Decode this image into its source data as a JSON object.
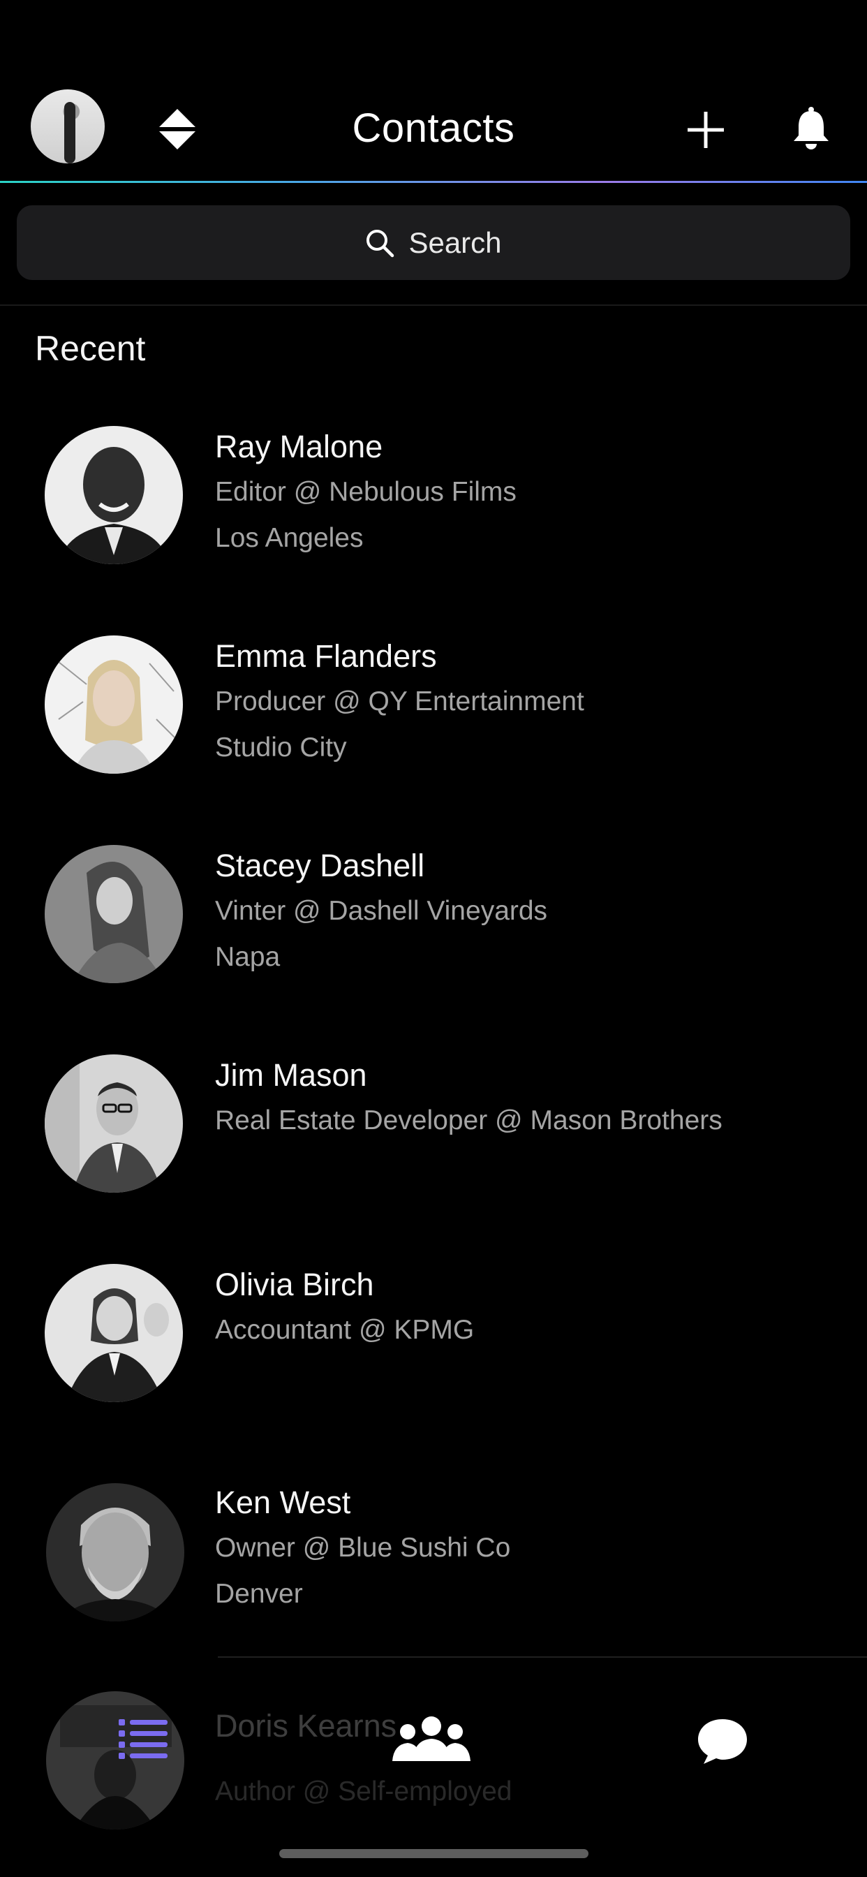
{
  "header": {
    "title": "Contacts"
  },
  "search": {
    "label": "Search"
  },
  "sections": {
    "recent": "Recent"
  },
  "contacts": [
    {
      "name": "Ray Malone",
      "role": "Editor @ Nebulous Films",
      "city": "Los Angeles"
    },
    {
      "name": "Emma Flanders",
      "role": "Producer @ QY Entertainment",
      "city": "Studio City"
    },
    {
      "name": "Stacey Dashell",
      "role": "Vinter @ Dashell Vineyards",
      "city": "Napa"
    },
    {
      "name": "Jim Mason",
      "role": "Real Estate Developer @ Mason Brothers",
      "city": ""
    },
    {
      "name": "Olivia Birch",
      "role": "Accountant @ KPMG",
      "city": ""
    },
    {
      "name": "Ken West",
      "role": "Owner @ Blue Sushi Co",
      "city": "Denver"
    },
    {
      "name": "Doris Kearns",
      "role": "Author @ Self-employed",
      "city": ""
    }
  ],
  "tabbar": {
    "items": [
      {
        "icon": "list-icon",
        "color": "#7b6cf0"
      },
      {
        "icon": "people-icon",
        "color": "#ffffff"
      },
      {
        "icon": "chat-icon",
        "color": "#ffffff"
      }
    ]
  },
  "colors": {
    "background": "#000000",
    "search_bg": "#1c1c1e",
    "accent_gradient": [
      "#2bd3c6",
      "#9b7be8",
      "#3f86f2"
    ],
    "secondary_text": "#a5a5a5"
  }
}
